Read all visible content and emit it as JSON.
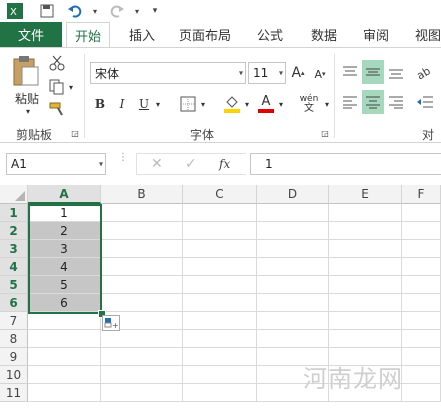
{
  "quick_access": {
    "icons": [
      "excel-logo-icon",
      "save-icon",
      "undo-icon",
      "redo-icon",
      "customize-icon"
    ]
  },
  "tabs": {
    "file": "文件",
    "items": [
      "开始",
      "插入",
      "页面布局",
      "公式",
      "数据",
      "审阅",
      "视图"
    ],
    "active_index": 0
  },
  "ribbon": {
    "clipboard": {
      "paste_label": "粘贴",
      "group_label": "剪贴板"
    },
    "font": {
      "font_name": "宋体",
      "font_size": "11",
      "bold": "B",
      "italic": "I",
      "underline": "U",
      "grow": "A",
      "shrink": "A",
      "font_color": "A",
      "phonetic": "wén",
      "group_label": "字体"
    },
    "alignment": {
      "group_label": "对齐"
    }
  },
  "formula_bar": {
    "name_box": "A1",
    "fx": "fx",
    "value": "1"
  },
  "grid": {
    "columns": [
      "A",
      "B",
      "C",
      "D",
      "E",
      "F"
    ],
    "rows": [
      "1",
      "2",
      "3",
      "4",
      "5",
      "6",
      "7",
      "8",
      "9",
      "10",
      "11"
    ],
    "a_values": [
      "1",
      "2",
      "3",
      "4",
      "5",
      "6"
    ]
  },
  "watermark": "河南龙网",
  "colors": {
    "accent": "#217346",
    "selection": "#c6c6c6"
  }
}
